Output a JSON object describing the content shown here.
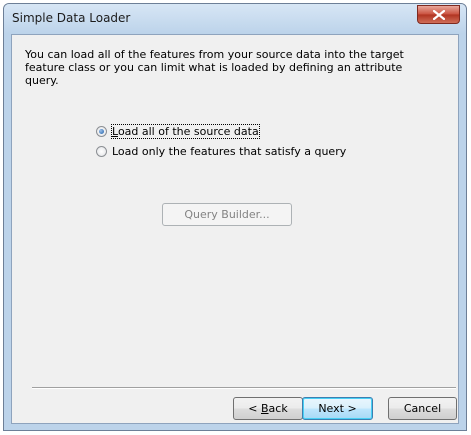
{
  "window": {
    "title": "Simple Data Loader",
    "close_icon": "close-icon"
  },
  "content": {
    "description": "You can load all of the features from your source data into the target feature class or you can limit what is loaded by defining an attribute query.",
    "options": [
      {
        "label_pre": "",
        "label_key": "L",
        "label_post": "oad all of the source data",
        "selected": true
      },
      {
        "label_pre": "",
        "label_key": "",
        "label_post": "Load only the features that satisfy a query",
        "selected": false
      }
    ],
    "query_builder_label": "Query Builder...",
    "query_builder_enabled": false
  },
  "footer": {
    "back_pre": "< ",
    "back_key": "B",
    "back_post": "ack",
    "next_label": "Next >",
    "cancel_label": "Cancel"
  }
}
